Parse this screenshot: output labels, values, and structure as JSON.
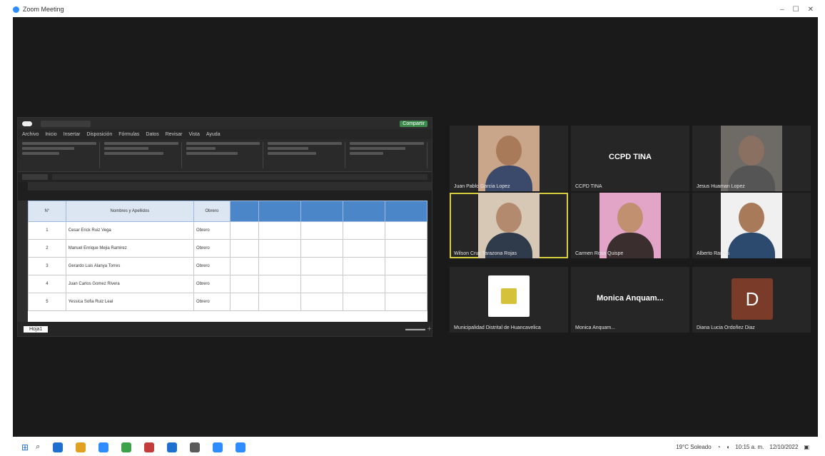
{
  "window": {
    "title": "Zoom Meeting"
  },
  "excel": {
    "title": "",
    "share_label": "Compartir",
    "menu": [
      "Archivo",
      "Inicio",
      "Insertar",
      "Disposición",
      "Fórmulas",
      "Datos",
      "Revisar",
      "Vista",
      "Ayuda"
    ],
    "headers": [
      "N°",
      "Nombres y Apellidos",
      "Obrero",
      "",
      "",
      "",
      "",
      ""
    ],
    "rows": [
      [
        "1",
        "Cesar Erick Ruiz Vega",
        "Obrero",
        "",
        "",
        "",
        "",
        ""
      ],
      [
        "2",
        "Manuel Enrique Mejia Ramirez",
        "Obrero",
        "",
        "",
        "",
        "",
        ""
      ],
      [
        "3",
        "Gerardo Luis Alanya Torres",
        "Obrero",
        "",
        "",
        "",
        "",
        ""
      ],
      [
        "4",
        "Juan Carlos Gomez Rivera",
        "Obrero",
        "",
        "",
        "",
        "",
        ""
      ],
      [
        "5",
        "Yessica Sofia Ruiz Leal",
        "Obrero",
        "",
        "",
        "",
        "",
        ""
      ]
    ],
    "sheet_tab": "Hoja1"
  },
  "participants": [
    {
      "name": "Juan Pablo Garcia Lopez",
      "kind": "video",
      "skin": "#a87a5a",
      "bg": "#c9a58a",
      "shirt": "#3b4a6b"
    },
    {
      "name": "CCPD TINA",
      "kind": "name",
      "label": "CCPD TINA"
    },
    {
      "name": "Jesus Huaman Lopez",
      "kind": "video",
      "skin": "#8a7060",
      "bg": "#6e6a66",
      "shirt": "#555"
    },
    {
      "name": "Wilson Cruz Tarazona Rojas",
      "kind": "video",
      "skin": "#b48a6e",
      "bg": "#d7c8b6",
      "shirt": "#2f3a4a",
      "active": true
    },
    {
      "name": "Carmen Rosa Quispe",
      "kind": "video",
      "skin": "#c09070",
      "bg": "#e2a5c8",
      "shirt": "#3a2e2e"
    },
    {
      "name": "Alberto Ramos",
      "kind": "video",
      "skin": "#a87a5a",
      "bg": "#f0f0f0",
      "shirt": "#2c4a6e"
    },
    {
      "name": "Municipalidad Distrital de Huancavelica",
      "kind": "logo"
    },
    {
      "name": "Monica Anquam...",
      "kind": "name",
      "label": "Monica Anquam..."
    },
    {
      "name": "Diana Lucia Ordoñez Diaz",
      "kind": "avatar",
      "letter": "D"
    }
  ],
  "taskbar": {
    "apps": [
      "#1f6fd0",
      "#e0a020",
      "#2d8cff",
      "#3ca24a",
      "#c43b3b",
      "#1f6fd0",
      "#5a5a5a",
      "#2d8cff",
      "#2d8cff"
    ],
    "weather": "19°C Soleado",
    "time": "10:15 a. m.",
    "date": "12/10/2022"
  }
}
